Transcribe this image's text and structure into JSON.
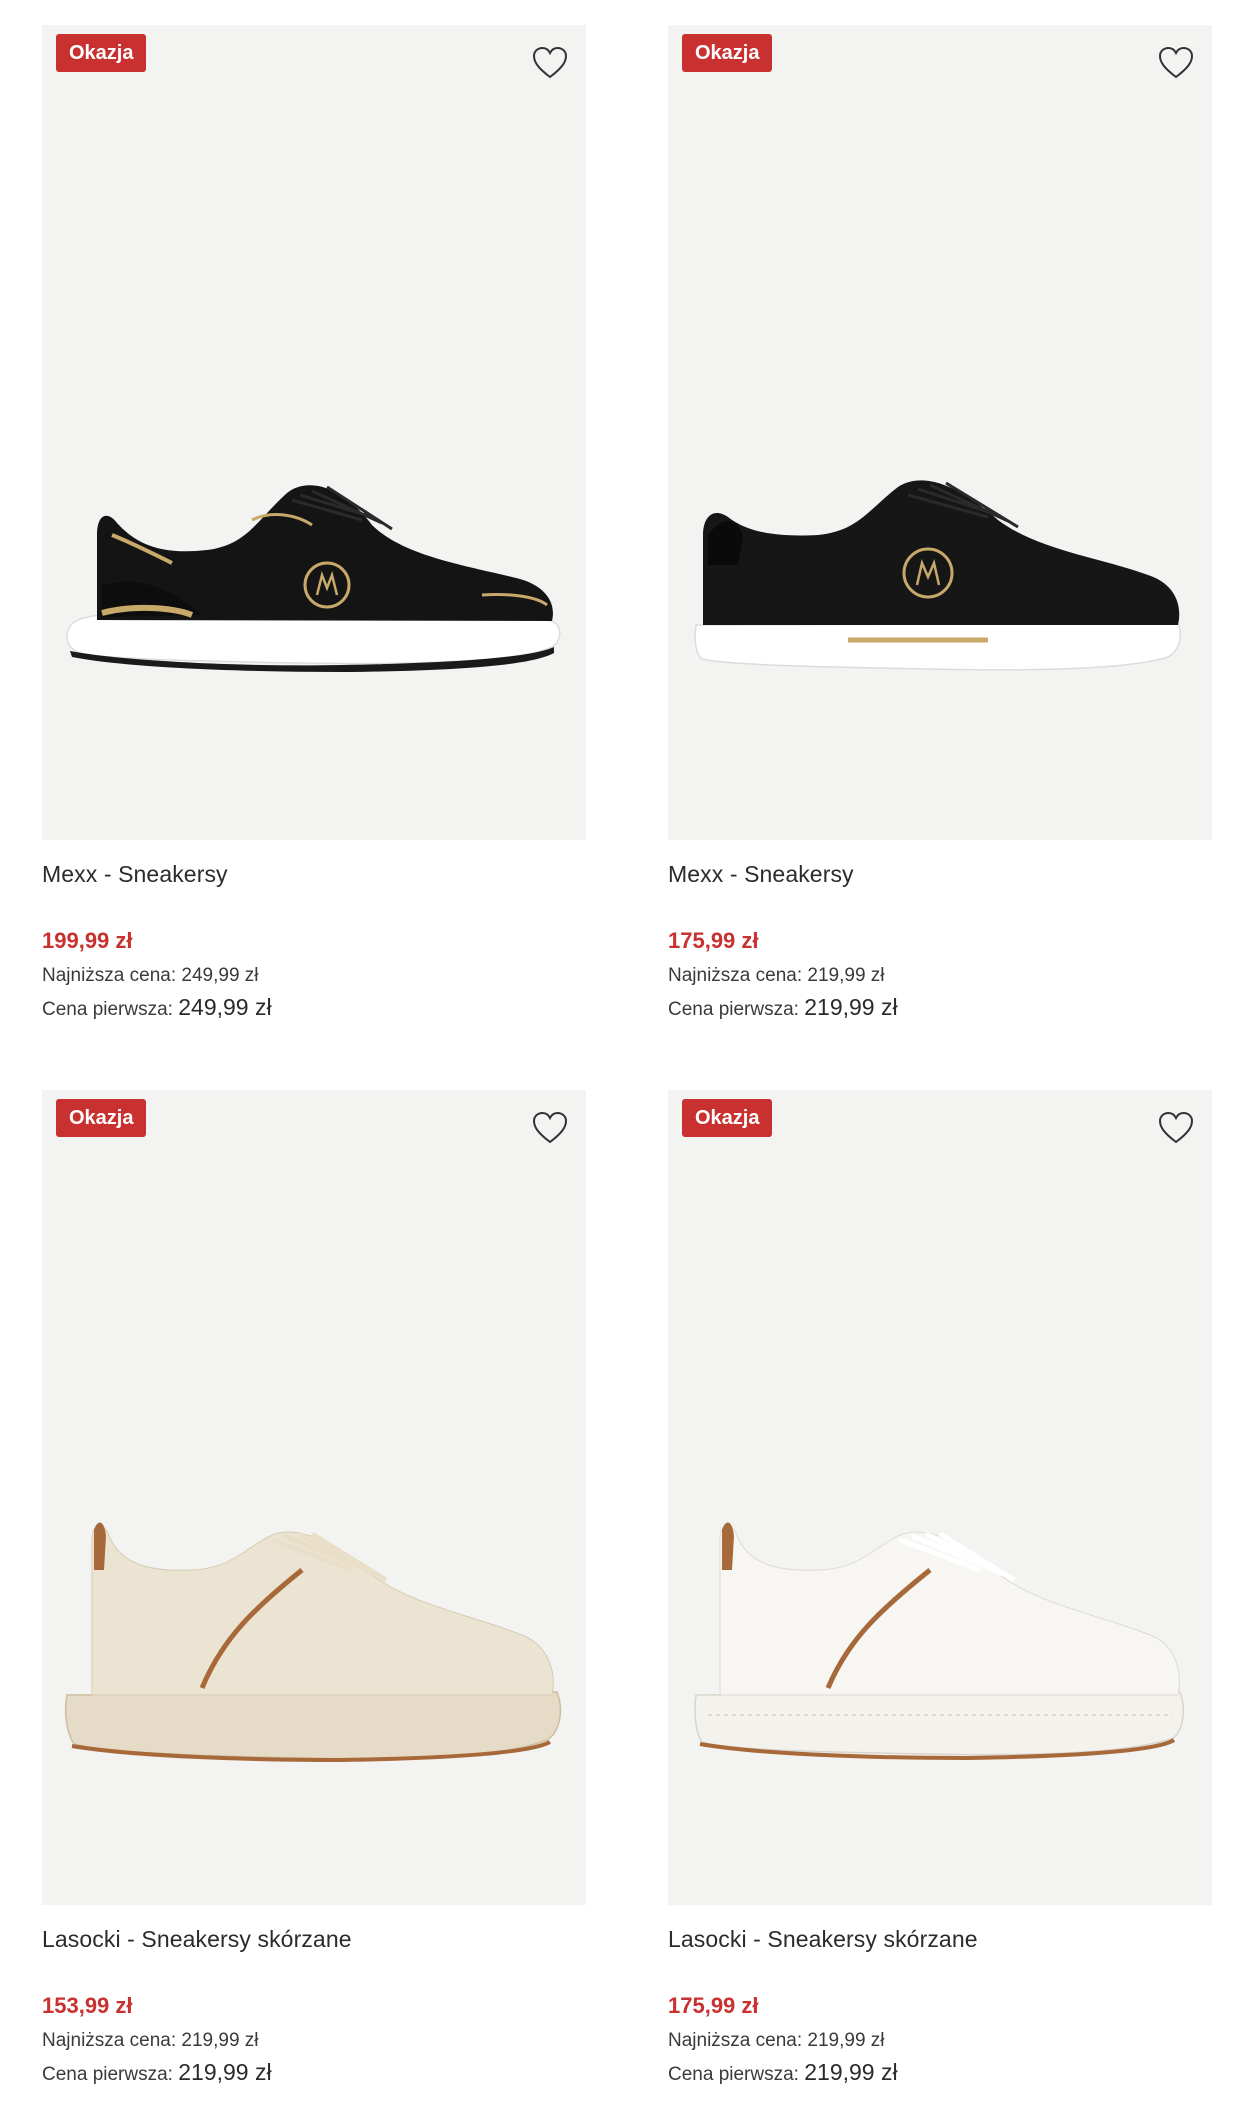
{
  "products": [
    {
      "badge": "Okazja",
      "title": "Mexx - Sneakersy",
      "price": "199,99 zł",
      "lowest_label": "Najniższa cena:",
      "lowest_value": "249,99 zł",
      "first_label": "Cena pierwsza:",
      "first_value": "249,99 zł",
      "icon": "heart-outline-icon",
      "shoe_colors": {
        "upper": "#141414",
        "sole": "#ffffff",
        "accent": "#c9a96a"
      }
    },
    {
      "badge": "Okazja",
      "title": "Mexx - Sneakersy",
      "price": "175,99 zł",
      "lowest_label": "Najniższa cena:",
      "lowest_value": "219,99 zł",
      "first_label": "Cena pierwsza:",
      "first_value": "219,99 zł",
      "icon": "heart-outline-icon",
      "shoe_colors": {
        "upper": "#161616",
        "sole": "#ffffff",
        "accent": "#c9a96a"
      }
    },
    {
      "badge": "Okazja",
      "title": "Lasocki - Sneakersy skórzane",
      "price": "153,99 zł",
      "lowest_label": "Najniższa cena:",
      "lowest_value": "219,99 zł",
      "first_label": "Cena pierwsza:",
      "first_value": "219,99 zł",
      "icon": "heart-outline-icon",
      "shoe_colors": {
        "upper": "#ece4d2",
        "sole": "#e6dbc6",
        "accent": "#a8693a"
      }
    },
    {
      "badge": "Okazja",
      "title": "Lasocki - Sneakersy skórzane",
      "price": "175,99 zł",
      "lowest_label": "Najniższa cena:",
      "lowest_value": "219,99 zł",
      "first_label": "Cena pierwsza:",
      "first_value": "219,99 zł",
      "icon": "heart-outline-icon",
      "shoe_colors": {
        "upper": "#f7f6f2",
        "sole": "#f4f2ec",
        "accent": "#a8693a"
      }
    }
  ],
  "colors": {
    "sale_red": "#c8312f",
    "image_bg": "#f3f3f2",
    "text": "#2b2b2b"
  }
}
